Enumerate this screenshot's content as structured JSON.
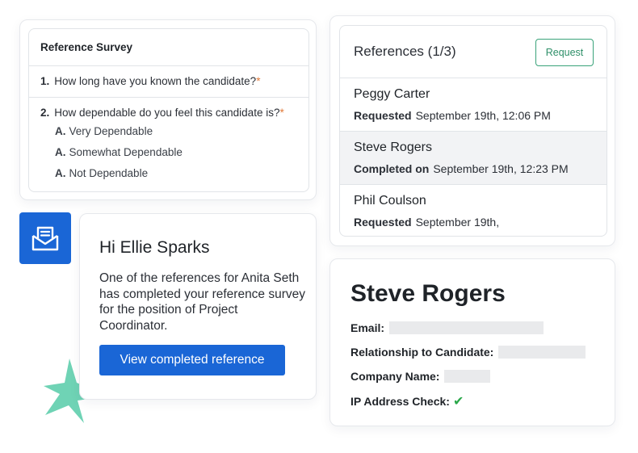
{
  "survey": {
    "title": "Reference Survey",
    "questions": [
      {
        "number": "1.",
        "text": "How long have you known the candidate?",
        "required_mark": "*"
      },
      {
        "number": "2.",
        "text": "How dependable do you feel this candidate is?",
        "required_mark": "*",
        "answers": [
          {
            "letter": "A.",
            "text": "Very Dependable"
          },
          {
            "letter": "A.",
            "text": "Somewhat Dependable"
          },
          {
            "letter": "A.",
            "text": "Not Dependable"
          }
        ]
      }
    ]
  },
  "references": {
    "title": "References (1/3)",
    "request_label": "Request",
    "items": [
      {
        "name": "Peggy Carter",
        "status_label": "Requested",
        "status_date": "September 19th, 12:06 PM"
      },
      {
        "name": "Steve Rogers",
        "status_label": "Completed on",
        "status_date": "September 19th, 12:23 PM"
      },
      {
        "name": "Phil Coulson",
        "status_label": "Requested",
        "status_date": "September 19th,"
      }
    ]
  },
  "notification": {
    "icon": "mail-inbox-icon",
    "greeting": "Hi Ellie Sparks",
    "body": "One of the references for Anita Seth has completed your reference survey for the position of Project Coordinator.",
    "button_label": "View completed reference"
  },
  "detail": {
    "name": "Steve Rogers",
    "fields": [
      {
        "label": "Email:"
      },
      {
        "label": "Relationship to Candidate:"
      },
      {
        "label": "Company Name:"
      },
      {
        "label": "IP Address Check:",
        "check": "✔"
      }
    ]
  },
  "colors": {
    "primary_blue": "#1a66d6",
    "request_green": "#3aa37a",
    "required_orange": "#e07a3a",
    "check_green": "#2aa84a",
    "star_teal": "#6fd3b5"
  }
}
